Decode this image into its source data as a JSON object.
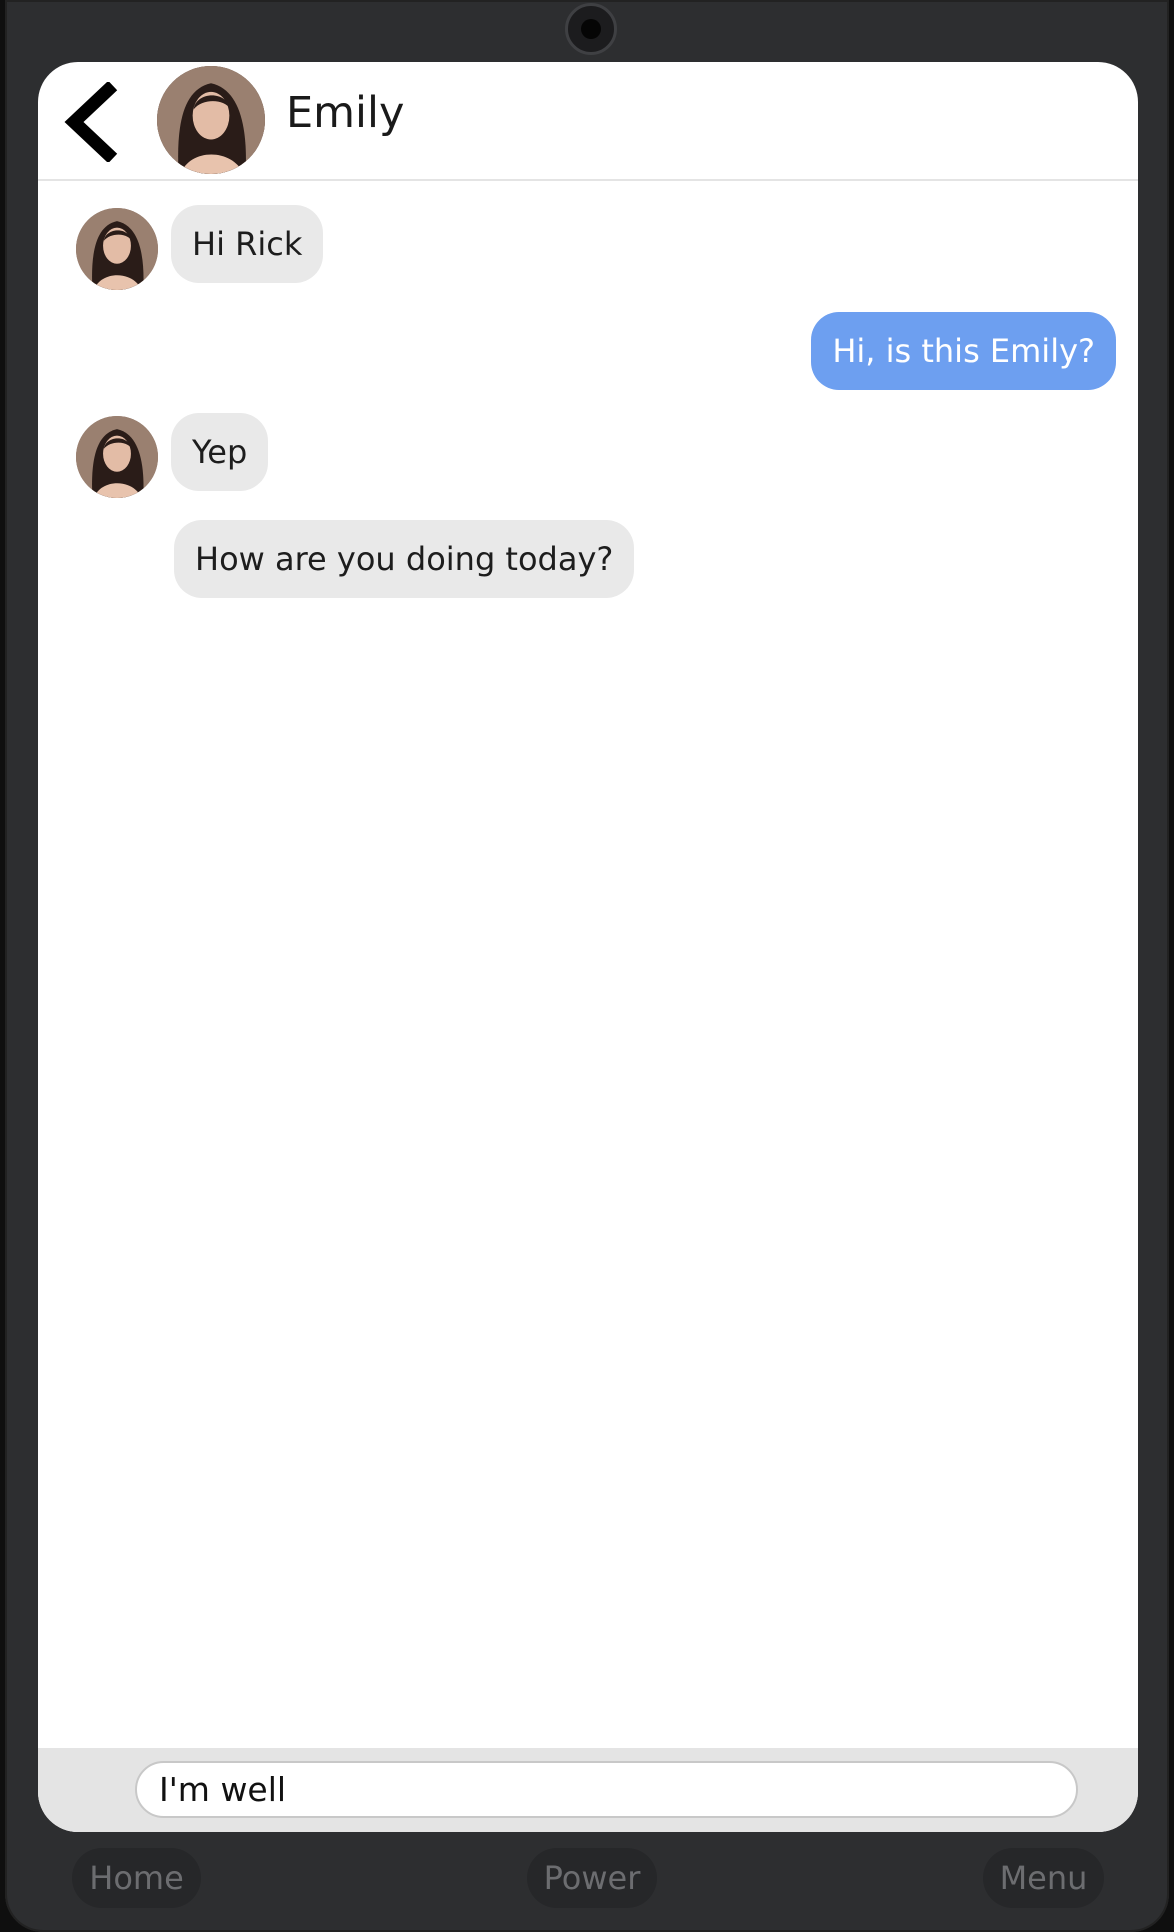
{
  "header": {
    "back_icon": "chevron-left-icon",
    "contact_name": "Emily"
  },
  "messages": [
    {
      "direction": "incoming",
      "text": "Hi Rick",
      "show_avatar": true
    },
    {
      "direction": "outgoing",
      "text": "Hi, is this Emily?"
    },
    {
      "direction": "incoming",
      "text": "Yep",
      "show_avatar": true
    },
    {
      "direction": "incoming",
      "text": "How are you doing today?",
      "show_avatar": false
    }
  ],
  "composer": {
    "value": "I'm well"
  },
  "device_buttons": {
    "home": "Home",
    "power": "Power",
    "menu": "Menu"
  },
  "colors": {
    "outgoing_bubble": "#6d9ff0",
    "incoming_bubble": "#e9e9e9",
    "device_frame": "#2d2e30"
  }
}
